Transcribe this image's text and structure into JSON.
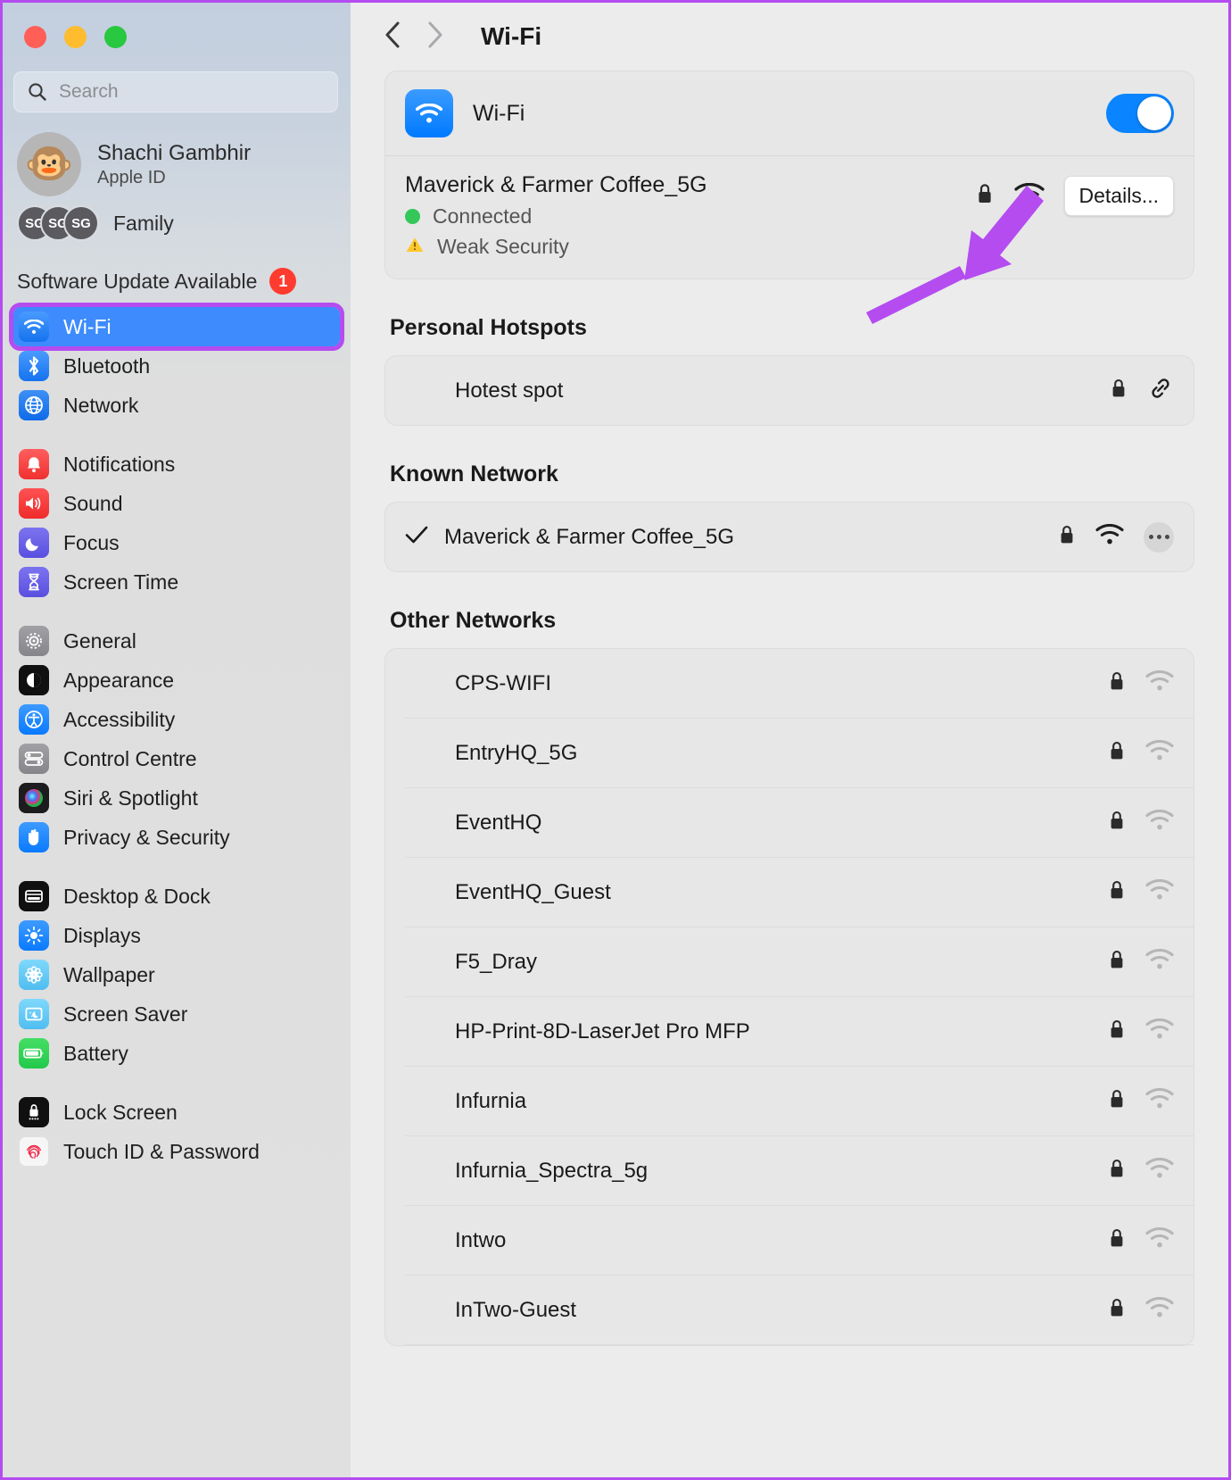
{
  "window": {
    "traffic_lights": [
      "close",
      "minimize",
      "zoom"
    ]
  },
  "sidebar": {
    "search": {
      "placeholder": "Search",
      "icon": "search-icon"
    },
    "account": {
      "name": "Shachi Gambhir",
      "subtitle": "Apple ID",
      "avatar_glyph": "🐵"
    },
    "family": {
      "label": "Family",
      "avatars": [
        "SG",
        "SG",
        "SG"
      ]
    },
    "software_update": {
      "label": "Software Update Available",
      "badge": "1"
    },
    "groups": [
      {
        "items": [
          {
            "label": "Wi-Fi",
            "icon": "wifi-icon",
            "color": "#2f7ff0",
            "selected": true
          },
          {
            "label": "Bluetooth",
            "icon": "bluetooth-icon",
            "color": "#2f7ff0",
            "selected": false
          },
          {
            "label": "Network",
            "icon": "globe-icon",
            "color": "#1e7bf0",
            "selected": false
          }
        ]
      },
      {
        "items": [
          {
            "label": "Notifications",
            "icon": "bell-icon",
            "color": "#f54b4b",
            "selected": false
          },
          {
            "label": "Sound",
            "icon": "speaker-icon",
            "color": "#f43c3c",
            "selected": false
          },
          {
            "label": "Focus",
            "icon": "moon-icon",
            "color": "#6157e0",
            "selected": false
          },
          {
            "label": "Screen Time",
            "icon": "hourglass-icon",
            "color": "#6157e0",
            "selected": false
          }
        ]
      },
      {
        "items": [
          {
            "label": "General",
            "icon": "gear-icon",
            "color": "#8e8e93",
            "selected": false
          },
          {
            "label": "Appearance",
            "icon": "appearance-icon",
            "color": "#111111",
            "selected": false
          },
          {
            "label": "Accessibility",
            "icon": "accessibility-icon",
            "color": "#0a84ff",
            "selected": false
          },
          {
            "label": "Control Centre",
            "icon": "switches-icon",
            "color": "#8e8e93",
            "selected": false
          },
          {
            "label": "Siri & Spotlight",
            "icon": "siri-icon",
            "color": "#1a1a1a",
            "selected": false
          },
          {
            "label": "Privacy & Security",
            "icon": "hand-icon",
            "color": "#0a84ff",
            "selected": false
          }
        ]
      },
      {
        "items": [
          {
            "label": "Desktop & Dock",
            "icon": "desktop-dock-icon",
            "color": "#111111",
            "selected": false
          },
          {
            "label": "Displays",
            "icon": "brightness-icon",
            "color": "#0a84ff",
            "selected": false
          },
          {
            "label": "Wallpaper",
            "icon": "flower-icon",
            "color": "#5ac8f5",
            "selected": false
          },
          {
            "label": "Screen Saver",
            "icon": "screensaver-icon",
            "color": "#5ac8f5",
            "selected": false
          },
          {
            "label": "Battery",
            "icon": "battery-icon",
            "color": "#2ecc55",
            "selected": false
          }
        ]
      },
      {
        "items": [
          {
            "label": "Lock Screen",
            "icon": "lock-screen-icon",
            "color": "#111111",
            "selected": false
          },
          {
            "label": "Touch ID & Password",
            "icon": "fingerprint-icon",
            "color": "#f7f7f7",
            "selected": false
          }
        ]
      }
    ]
  },
  "main": {
    "nav": {
      "back_icon": "chevron-left-icon",
      "forward_icon": "chevron-right-icon"
    },
    "title": "Wi-Fi",
    "wifi_card": {
      "label": "Wi-Fi",
      "icon": "wifi-icon",
      "toggle_on": true,
      "connected_network": {
        "ssid": "Maverick & Farmer Coffee_5G",
        "status": "Connected",
        "security_warning": "Weak Security",
        "lock_icon": "lock-icon",
        "signal_icon": "wifi-signal-icon",
        "details_button": "Details..."
      }
    },
    "sections": [
      {
        "title": "Personal Hotspots",
        "rows": [
          {
            "name": "Hotest spot",
            "checked": false,
            "icons": [
              "lock-icon",
              "link-icon"
            ]
          }
        ]
      },
      {
        "title": "Known Network",
        "rows": [
          {
            "name": "Maverick & Farmer Coffee_5G",
            "checked": true,
            "icons": [
              "lock-icon",
              "wifi-signal-icon",
              "more-icon"
            ]
          }
        ]
      },
      {
        "title": "Other Networks",
        "rows": [
          {
            "name": "CPS-WIFI",
            "checked": false,
            "icons": [
              "lock-icon",
              "wifi-signal-faded-icon"
            ]
          },
          {
            "name": "EntryHQ_5G",
            "checked": false,
            "icons": [
              "lock-icon",
              "wifi-signal-faded-icon"
            ]
          },
          {
            "name": "EventHQ",
            "checked": false,
            "icons": [
              "lock-icon",
              "wifi-signal-faded-icon"
            ]
          },
          {
            "name": "EventHQ_Guest",
            "checked": false,
            "icons": [
              "lock-icon",
              "wifi-signal-faded-icon"
            ]
          },
          {
            "name": "F5_Dray",
            "checked": false,
            "icons": [
              "lock-icon",
              "wifi-signal-faded-icon"
            ]
          },
          {
            "name": "HP-Print-8D-LaserJet Pro MFP",
            "checked": false,
            "icons": [
              "lock-icon",
              "wifi-signal-faded-icon"
            ]
          },
          {
            "name": "Infurnia",
            "checked": false,
            "icons": [
              "lock-icon",
              "wifi-signal-faded-icon"
            ]
          },
          {
            "name": "Infurnia_Spectra_5g",
            "checked": false,
            "icons": [
              "lock-icon",
              "wifi-signal-faded-icon"
            ]
          },
          {
            "name": "Intwo",
            "checked": false,
            "icons": [
              "lock-icon",
              "wifi-signal-faded-icon"
            ]
          },
          {
            "name": "InTwo-Guest",
            "checked": false,
            "icons": [
              "lock-icon",
              "wifi-signal-faded-icon"
            ]
          }
        ]
      }
    ]
  },
  "annotation": {
    "arrow_color": "#b44cf0",
    "highlight_color": "#b44cf0",
    "points_at": "Details..."
  }
}
